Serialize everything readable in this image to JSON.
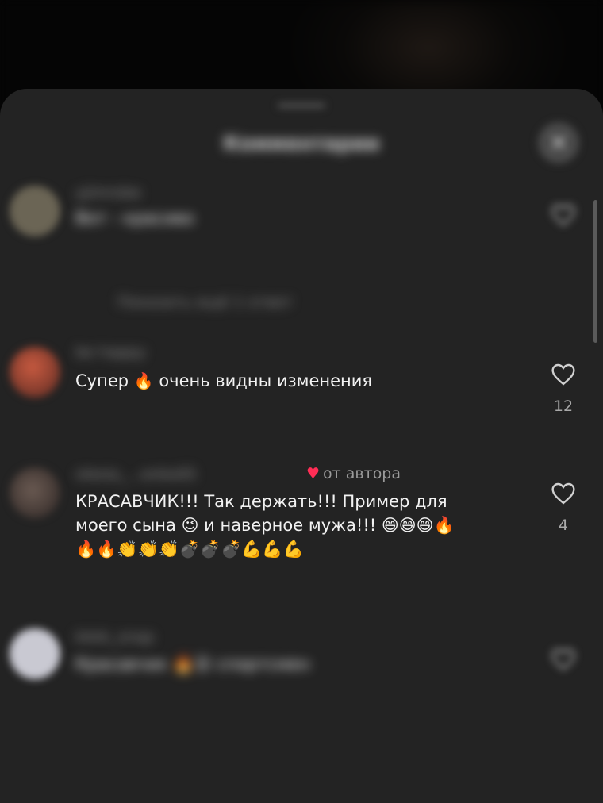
{
  "sheet": {
    "title": "Комментарии",
    "close_glyph": "×"
  },
  "comments": [
    {
      "username": "yjimrobe",
      "text": "Вот - красиво",
      "replies_label": "Показать ещё 1 ответ",
      "avatar_color": "#6b6555"
    },
    {
      "username": "be happy",
      "text_parts": [
        "Супер ",
        "🔥",
        " очень видны изменения"
      ],
      "likes": "12",
      "avatar_color": "#a84232"
    },
    {
      "username": "olesia_...enko05",
      "author_label": "от автора",
      "text_line1": "КРАСАВЧИК!!! Так держать!!! Пример для",
      "text_line2": "моего сына 😉 и наверное мужа!!! 😄😄😄🔥",
      "text_line3": "🔥🔥👏👏👏💣💣💣💪💪💪",
      "likes": "4",
      "avatar_color": "#5b4a44"
    },
    {
      "username": "kkkk_snap",
      "text": "Красавчик 🔥😮 спортсмен",
      "avatar_color": "#c9c9d2"
    }
  ],
  "colors": {
    "sheet_bg": "#232323",
    "author_heart": "#ff2d55"
  },
  "icons": {
    "like": "heart-outline-icon",
    "close": "close-icon"
  }
}
